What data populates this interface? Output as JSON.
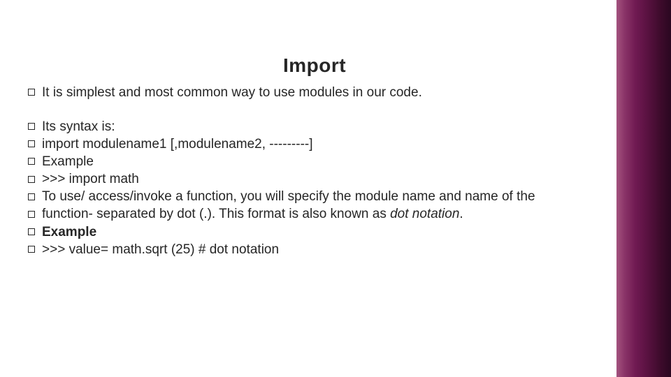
{
  "title": "Import",
  "bullets_top": [
    {
      "parts": [
        {
          "t": "It is simplest and most common way to use modules in our code."
        }
      ]
    }
  ],
  "bullets_main": [
    {
      "parts": [
        {
          "t": "Its syntax is:"
        }
      ]
    },
    {
      "parts": [
        {
          "t": "import modulename1 [,modulename2, ---------]"
        }
      ]
    },
    {
      "parts": [
        {
          "t": "Example"
        }
      ]
    },
    {
      "parts": [
        {
          "t": ">>> import math"
        }
      ]
    },
    {
      "parts": [
        {
          "t": "To use/ access/invoke a function, you will specify the module name and name of the"
        }
      ]
    },
    {
      "parts": [
        {
          "t": "function- separated by dot (.). This format is also known as "
        },
        {
          "t": "dot notation",
          "i": true
        },
        {
          "t": "."
        }
      ]
    },
    {
      "parts": [
        {
          "t": "Example",
          "b": true
        }
      ]
    },
    {
      "parts": [
        {
          "t": ">>> value= math.sqrt (25) # dot notation"
        }
      ]
    }
  ]
}
